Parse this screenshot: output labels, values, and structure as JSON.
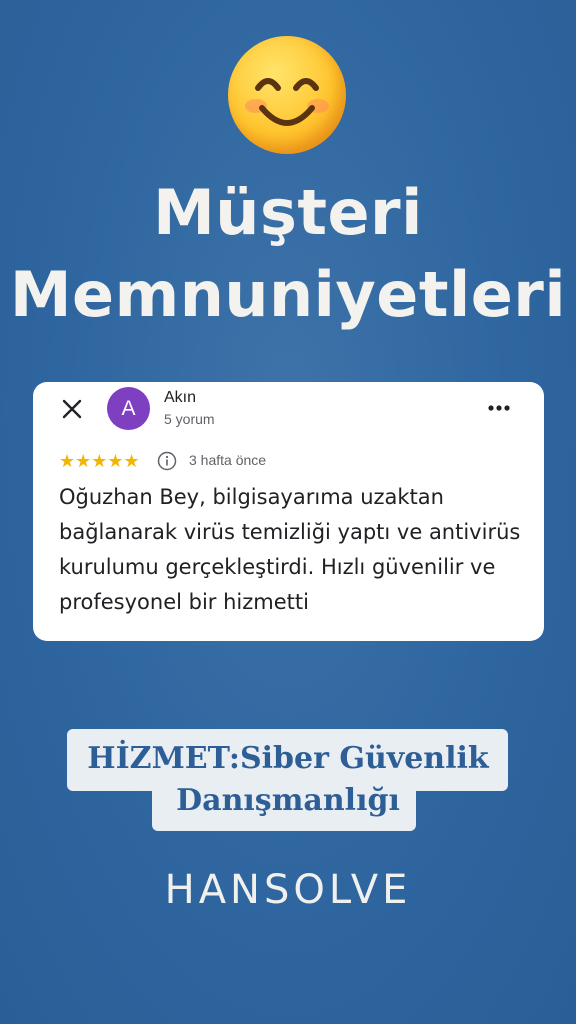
{
  "header": {
    "emoji_icon": "smiling-face-with-smiling-eyes",
    "title_line1": "Müşteri",
    "title_line2": "Memnuniyetleri"
  },
  "review": {
    "avatar_letter": "A",
    "reviewer_name": "Akın",
    "review_count": "5 yorum",
    "rating": 5,
    "stars": "★★★★★",
    "time_ago": "3 hafta önce",
    "text": "Oğuzhan Bey, bilgisayarıma uzaktan bağlanarak virüs temizliği yaptı ve antivirüs kurulumu gerçekleştirdi. Hızlı güvenilir ve profesyonel bir hizmetti"
  },
  "service": {
    "line1": "HİZMET:Siber Güvenlik",
    "line2": "Danışmanlığı"
  },
  "brand": "HANSOLVE",
  "colors": {
    "background": "#2f66a0",
    "star": "#f4b400",
    "avatar": "#7e3fc0",
    "service_text": "#2d5e96"
  }
}
